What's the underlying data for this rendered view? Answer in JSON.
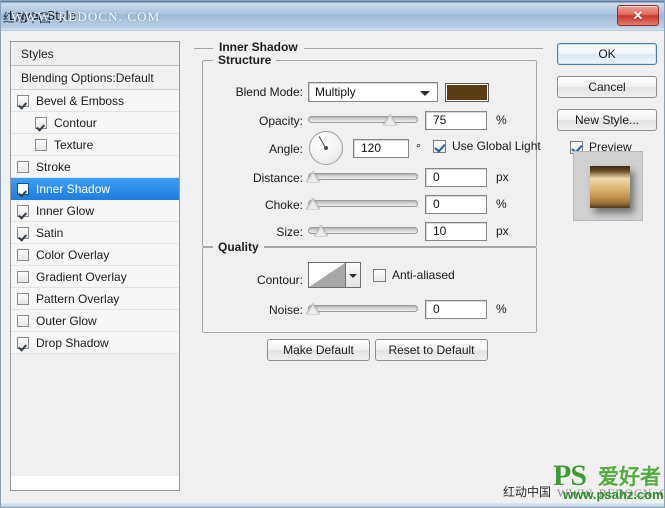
{
  "window": {
    "title": "Layer Style",
    "close_label": "✕",
    "watermark_title": "WWW. REDOCN. COM",
    "watermark_title_cn": "红动中国"
  },
  "styles_panel": {
    "header": "Styles",
    "blending_options": "Blending Options:Default",
    "items": [
      {
        "label": "Bevel & Emboss",
        "checked": true,
        "indent": false
      },
      {
        "label": "Contour",
        "checked": true,
        "indent": true
      },
      {
        "label": "Texture",
        "checked": false,
        "indent": true
      },
      {
        "label": "Stroke",
        "checked": false,
        "indent": false
      },
      {
        "label": "Inner Shadow",
        "checked": true,
        "indent": false,
        "selected": true
      },
      {
        "label": "Inner Glow",
        "checked": true,
        "indent": false
      },
      {
        "label": "Satin",
        "checked": true,
        "indent": false
      },
      {
        "label": "Color Overlay",
        "checked": false,
        "indent": false
      },
      {
        "label": "Gradient Overlay",
        "checked": false,
        "indent": false
      },
      {
        "label": "Pattern Overlay",
        "checked": false,
        "indent": false
      },
      {
        "label": "Outer Glow",
        "checked": false,
        "indent": false
      },
      {
        "label": "Drop Shadow",
        "checked": true,
        "indent": false
      }
    ]
  },
  "main": {
    "section_title": "Inner Shadow",
    "structure": {
      "title": "Structure",
      "blend_mode_label": "Blend Mode:",
      "blend_mode_value": "Multiply",
      "shadow_color": "#5a3d14",
      "opacity_label": "Opacity:",
      "opacity_value": "75",
      "opacity_unit": "%",
      "angle_label": "Angle:",
      "angle_value": "120",
      "angle_unit": "°",
      "use_global_light": "Use Global Light",
      "use_global_light_checked": true,
      "distance_label": "Distance:",
      "distance_value": "0",
      "distance_unit": "px",
      "choke_label": "Choke:",
      "choke_value": "0",
      "choke_unit": "%",
      "size_label": "Size:",
      "size_value": "10",
      "size_unit": "px"
    },
    "quality": {
      "title": "Quality",
      "contour_label": "Contour:",
      "anti_aliased_label": "Anti-aliased",
      "anti_aliased_checked": false,
      "noise_label": "Noise:",
      "noise_value": "0",
      "noise_unit": "%"
    },
    "make_default": "Make Default",
    "reset_to_default": "Reset to Default"
  },
  "buttons": {
    "ok": "OK",
    "cancel": "Cancel",
    "new_style": "New Style...",
    "preview": "Preview",
    "preview_checked": true
  },
  "footer_watermark": {
    "cn_text": "红动中国",
    "redocn": "WWW. REDOCN. COM",
    "ps_mark": "PS",
    "ps_cn": "爱好者",
    "ps_site": "www.psahz.com"
  }
}
